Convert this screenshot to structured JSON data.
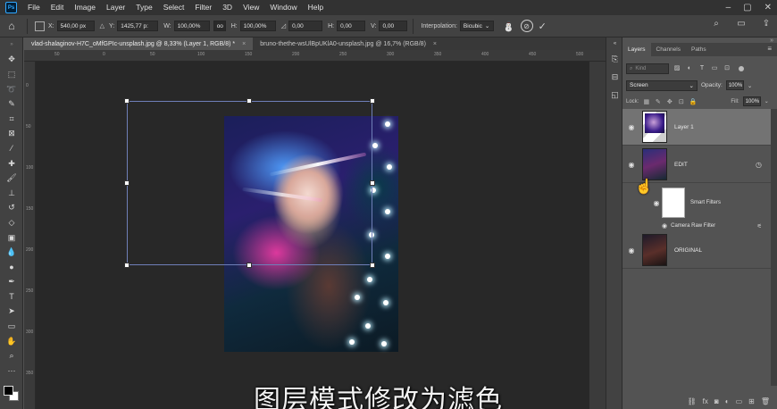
{
  "app": {
    "logo": "Ps",
    "menu": [
      "File",
      "Edit",
      "Image",
      "Layer",
      "Type",
      "Select",
      "Filter",
      "3D",
      "View",
      "Window",
      "Help"
    ],
    "window_controls": [
      "–",
      "▢",
      "✕"
    ]
  },
  "options": {
    "x_label": "X:",
    "x_value": "540,00 px",
    "y_label": "Y:",
    "y_value": "1425,77 p:",
    "w_label": "W:",
    "w_value": "100,00%",
    "link_label": "oo",
    "h_label": "H:",
    "h_value": "100,00%",
    "rot_value": "0,00",
    "hskew_label": "H:",
    "hskew_value": "0,00",
    "vskew_label": "V:",
    "vskew_value": "0,00",
    "interp_label": "Interpolation:",
    "interp_value": "Bicubic"
  },
  "tabs": [
    {
      "label": "vlad-shalaginov-H7C_oMfGPIc-unsplash.jpg @ 8,33% (Layer 1, RGB/8) *",
      "close": "×"
    },
    {
      "label": "bruno-thethe-wsUlBpUKlA0-unsplash.jpg @ 16,7% (RGB/8)",
      "close": "×"
    }
  ],
  "rulers": {
    "h_ticks": [
      "50",
      "0",
      "50",
      "100",
      "150",
      "200",
      "250",
      "300",
      "350",
      "400",
      "450",
      "500"
    ],
    "v_ticks": [
      "0",
      "50",
      "100",
      "150",
      "200",
      "250",
      "300",
      "350"
    ]
  },
  "caption": "图层模式修改为滤色",
  "layers_panel": {
    "tabs": [
      "Layers",
      "Channels",
      "Paths"
    ],
    "kind_placeholder": "Kind",
    "blend_mode": "Screen",
    "opacity_label": "Opacity:",
    "opacity_value": "100%",
    "lock_label": "Lock:",
    "fill_label": "Fill:",
    "fill_value": "100%",
    "layers": [
      {
        "name": "Layer 1"
      },
      {
        "name": "EDIT"
      },
      {
        "name": "Smart Filters"
      },
      {
        "name": "Camera Raw Filter"
      },
      {
        "name": "ORIGINAL"
      }
    ]
  },
  "colors": {
    "canvas_bg": "#282828",
    "panel_bg": "#535353",
    "selected_layer": "#737373",
    "transform_box": "#6f7fb8"
  }
}
